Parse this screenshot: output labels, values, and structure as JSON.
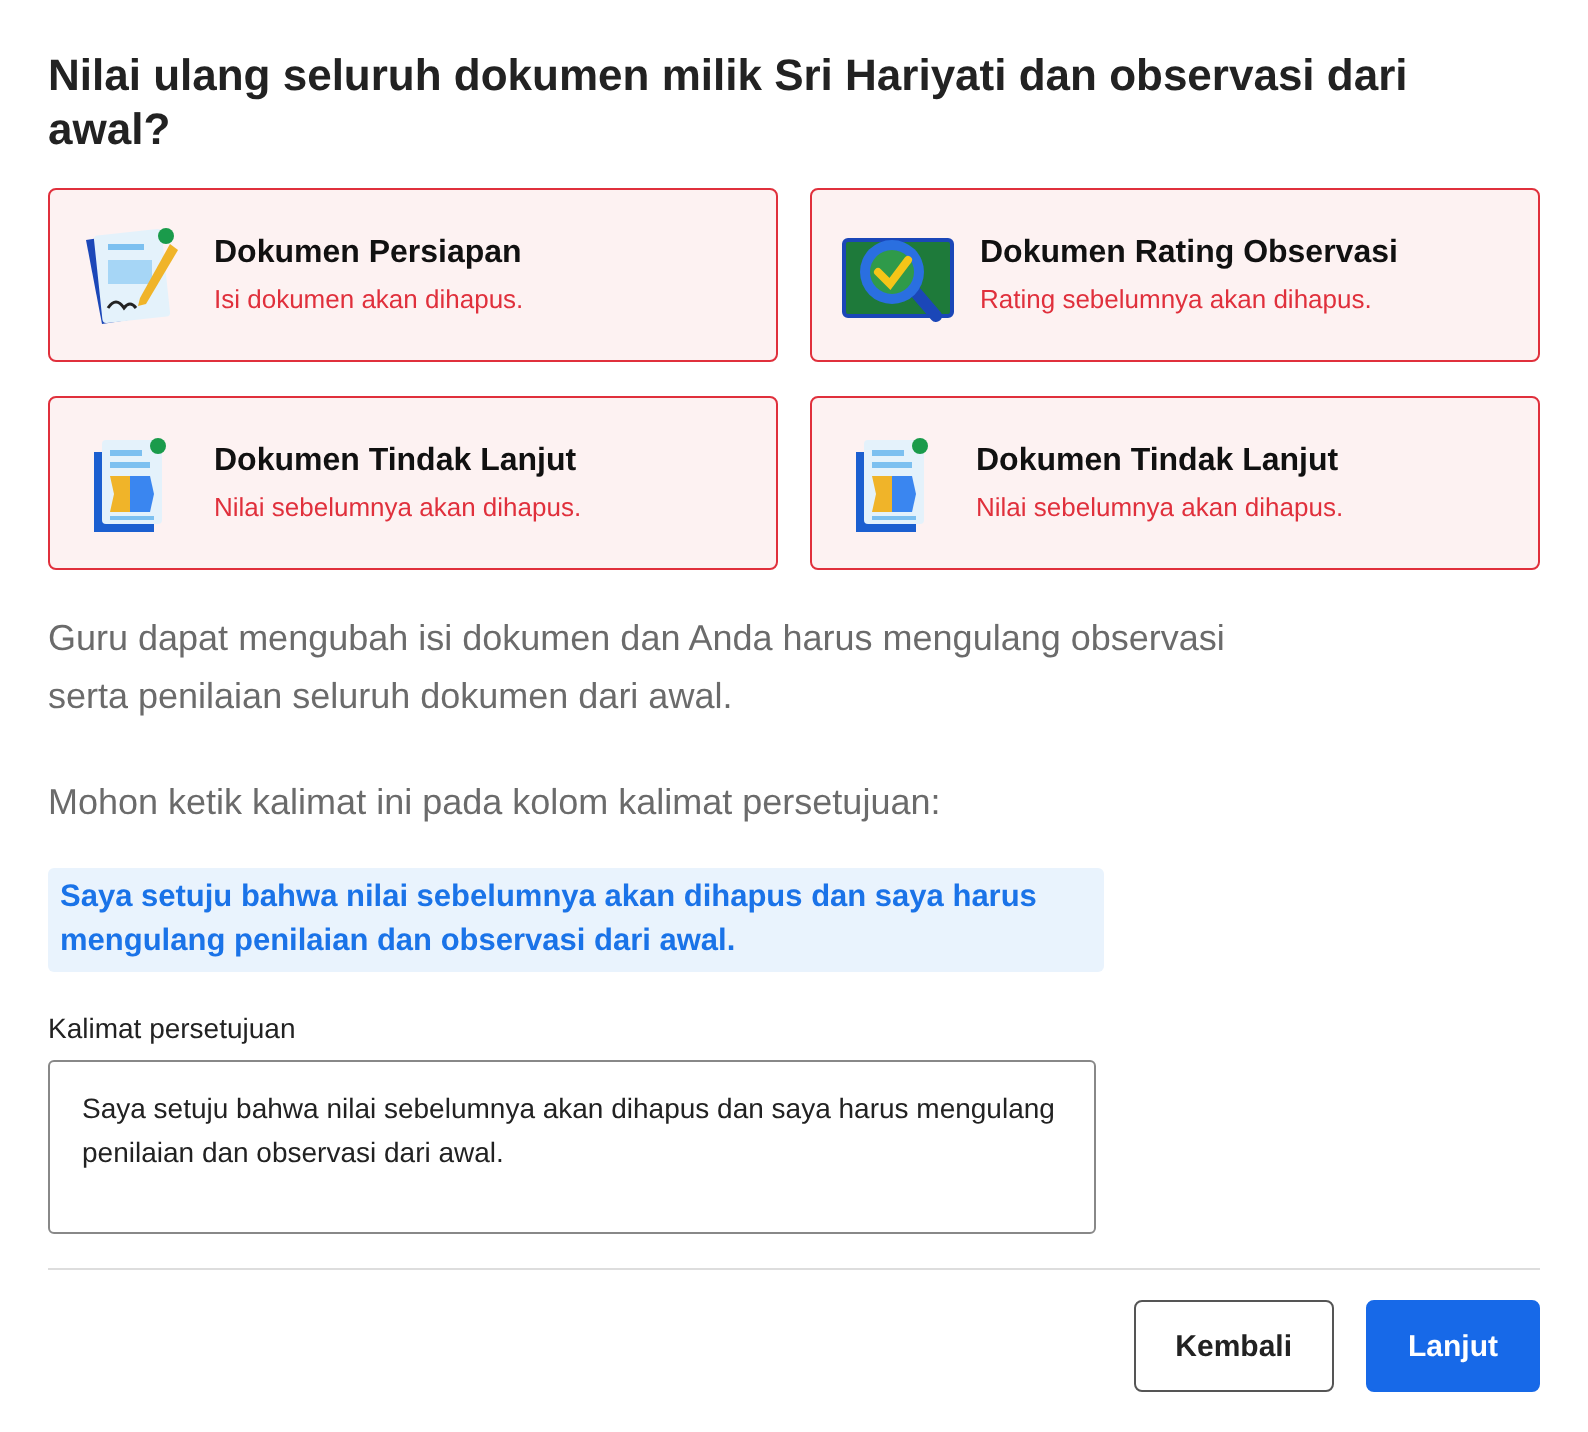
{
  "title": "Nilai ulang seluruh dokumen milik Sri Hariyati dan observasi dari awal?",
  "documents": [
    {
      "kind": "persiapan",
      "name": "Dokumen Persiapan",
      "warning": "Isi dokumen akan dihapus."
    },
    {
      "kind": "rating",
      "name": "Dokumen Rating Observasi",
      "warning": "Rating sebelumnya akan dihapus."
    },
    {
      "kind": "tindak",
      "name": "Dokumen Tindak Lanjut",
      "warning": "Nilai sebelumnya akan dihapus."
    },
    {
      "kind": "tindak",
      "name": "Dokumen Tindak Lanjut",
      "warning": "Nilai sebelumnya akan dihapus."
    }
  ],
  "description": "Guru dapat mengubah isi dokumen dan Anda harus mengulang observasi serta penilaian seluruh dokumen dari awal.",
  "instruction": "Mohon ketik kalimat ini pada kolom kalimat persetujuan:",
  "agreement_sentence": "Saya setuju bahwa nilai sebelumnya akan dihapus dan saya harus mengulang penilaian dan observasi dari awal.",
  "field": {
    "label": "Kalimat persetujuan",
    "value": "Saya setuju bahwa nilai sebelumnya akan dihapus dan saya harus mengulang penilaian dan observasi dari awal."
  },
  "buttons": [
    {
      "kind": "secondary",
      "label": "Kembali"
    },
    {
      "kind": "primary",
      "label": "Lanjut"
    }
  ]
}
